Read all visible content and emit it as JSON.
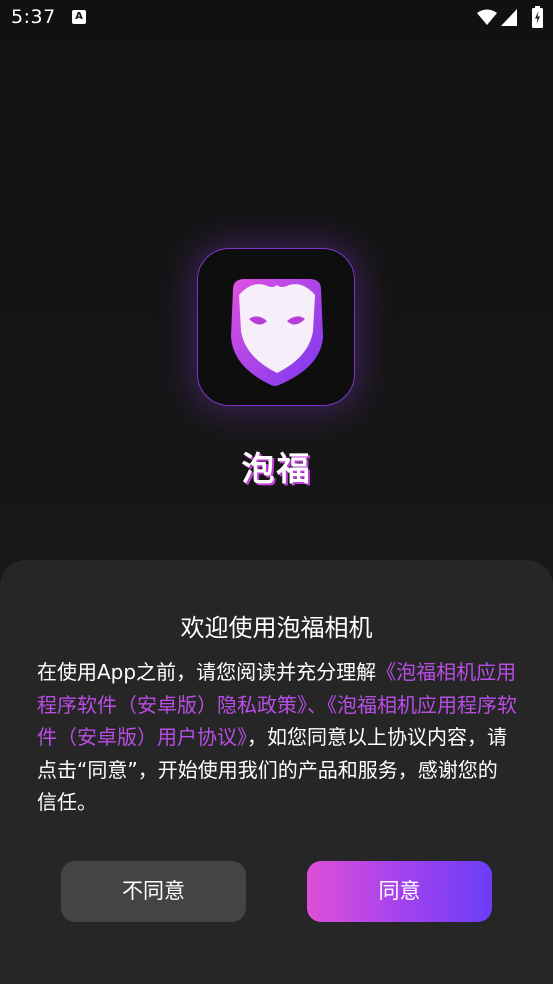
{
  "status_bar": {
    "time": "5:37",
    "left_icons": [
      "a-badge-icon"
    ],
    "right_icons": [
      "wifi-icon",
      "cell-signal-icon",
      "battery-charging-icon"
    ]
  },
  "app": {
    "name": "泡福",
    "icon": "mask-logo-icon",
    "accent": "#b94de6"
  },
  "dialog": {
    "title": "欢迎使用泡福相机",
    "body_prefix": "在使用App之前，请您阅读并充分理解",
    "privacy_link": "《泡福相机应用程序软件（安卓版）隐私政策》",
    "separator": "、",
    "agreement_link": "《泡福相机应用程序软件（安卓版）用户协议》",
    "body_suffix": "，如您同意以上协议内容，请点击“同意”，开始使用我们的产品和服务，感谢您的信任。",
    "disagree_label": "不同意",
    "agree_label": "同意"
  }
}
